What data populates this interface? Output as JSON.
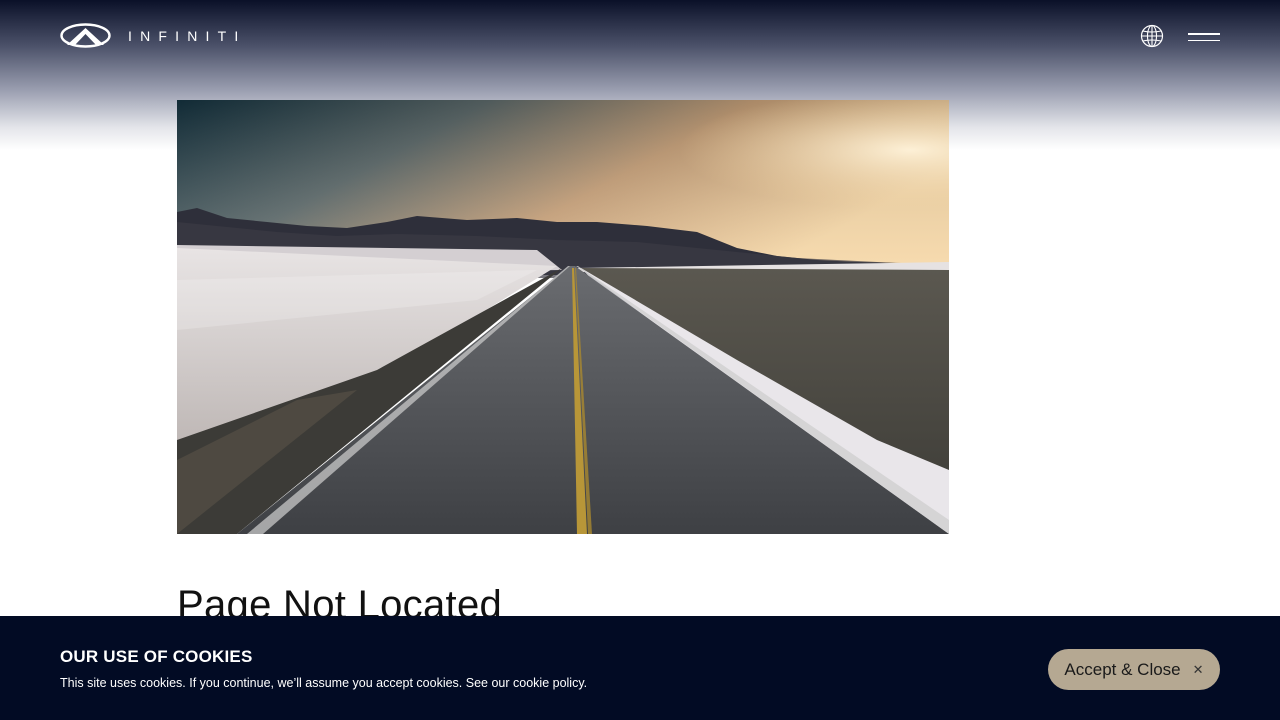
{
  "header": {
    "brand": "INFINITI",
    "globe_icon": "globe-icon",
    "menu_icon": "hamburger-menu-icon"
  },
  "main": {
    "title": "Page Not Located"
  },
  "cookie_banner": {
    "title": "OUR USE OF COOKIES",
    "text": "This site uses cookies. If you continue, we’ll assume you accept cookies. See our",
    "link": "cookie policy.",
    "accept_label": "Accept & Close",
    "close_icon": "close-icon"
  },
  "colors": {
    "cookie_bg": "#020b24",
    "accept_bg": "#b5a892",
    "header_top": "#0a1028"
  }
}
